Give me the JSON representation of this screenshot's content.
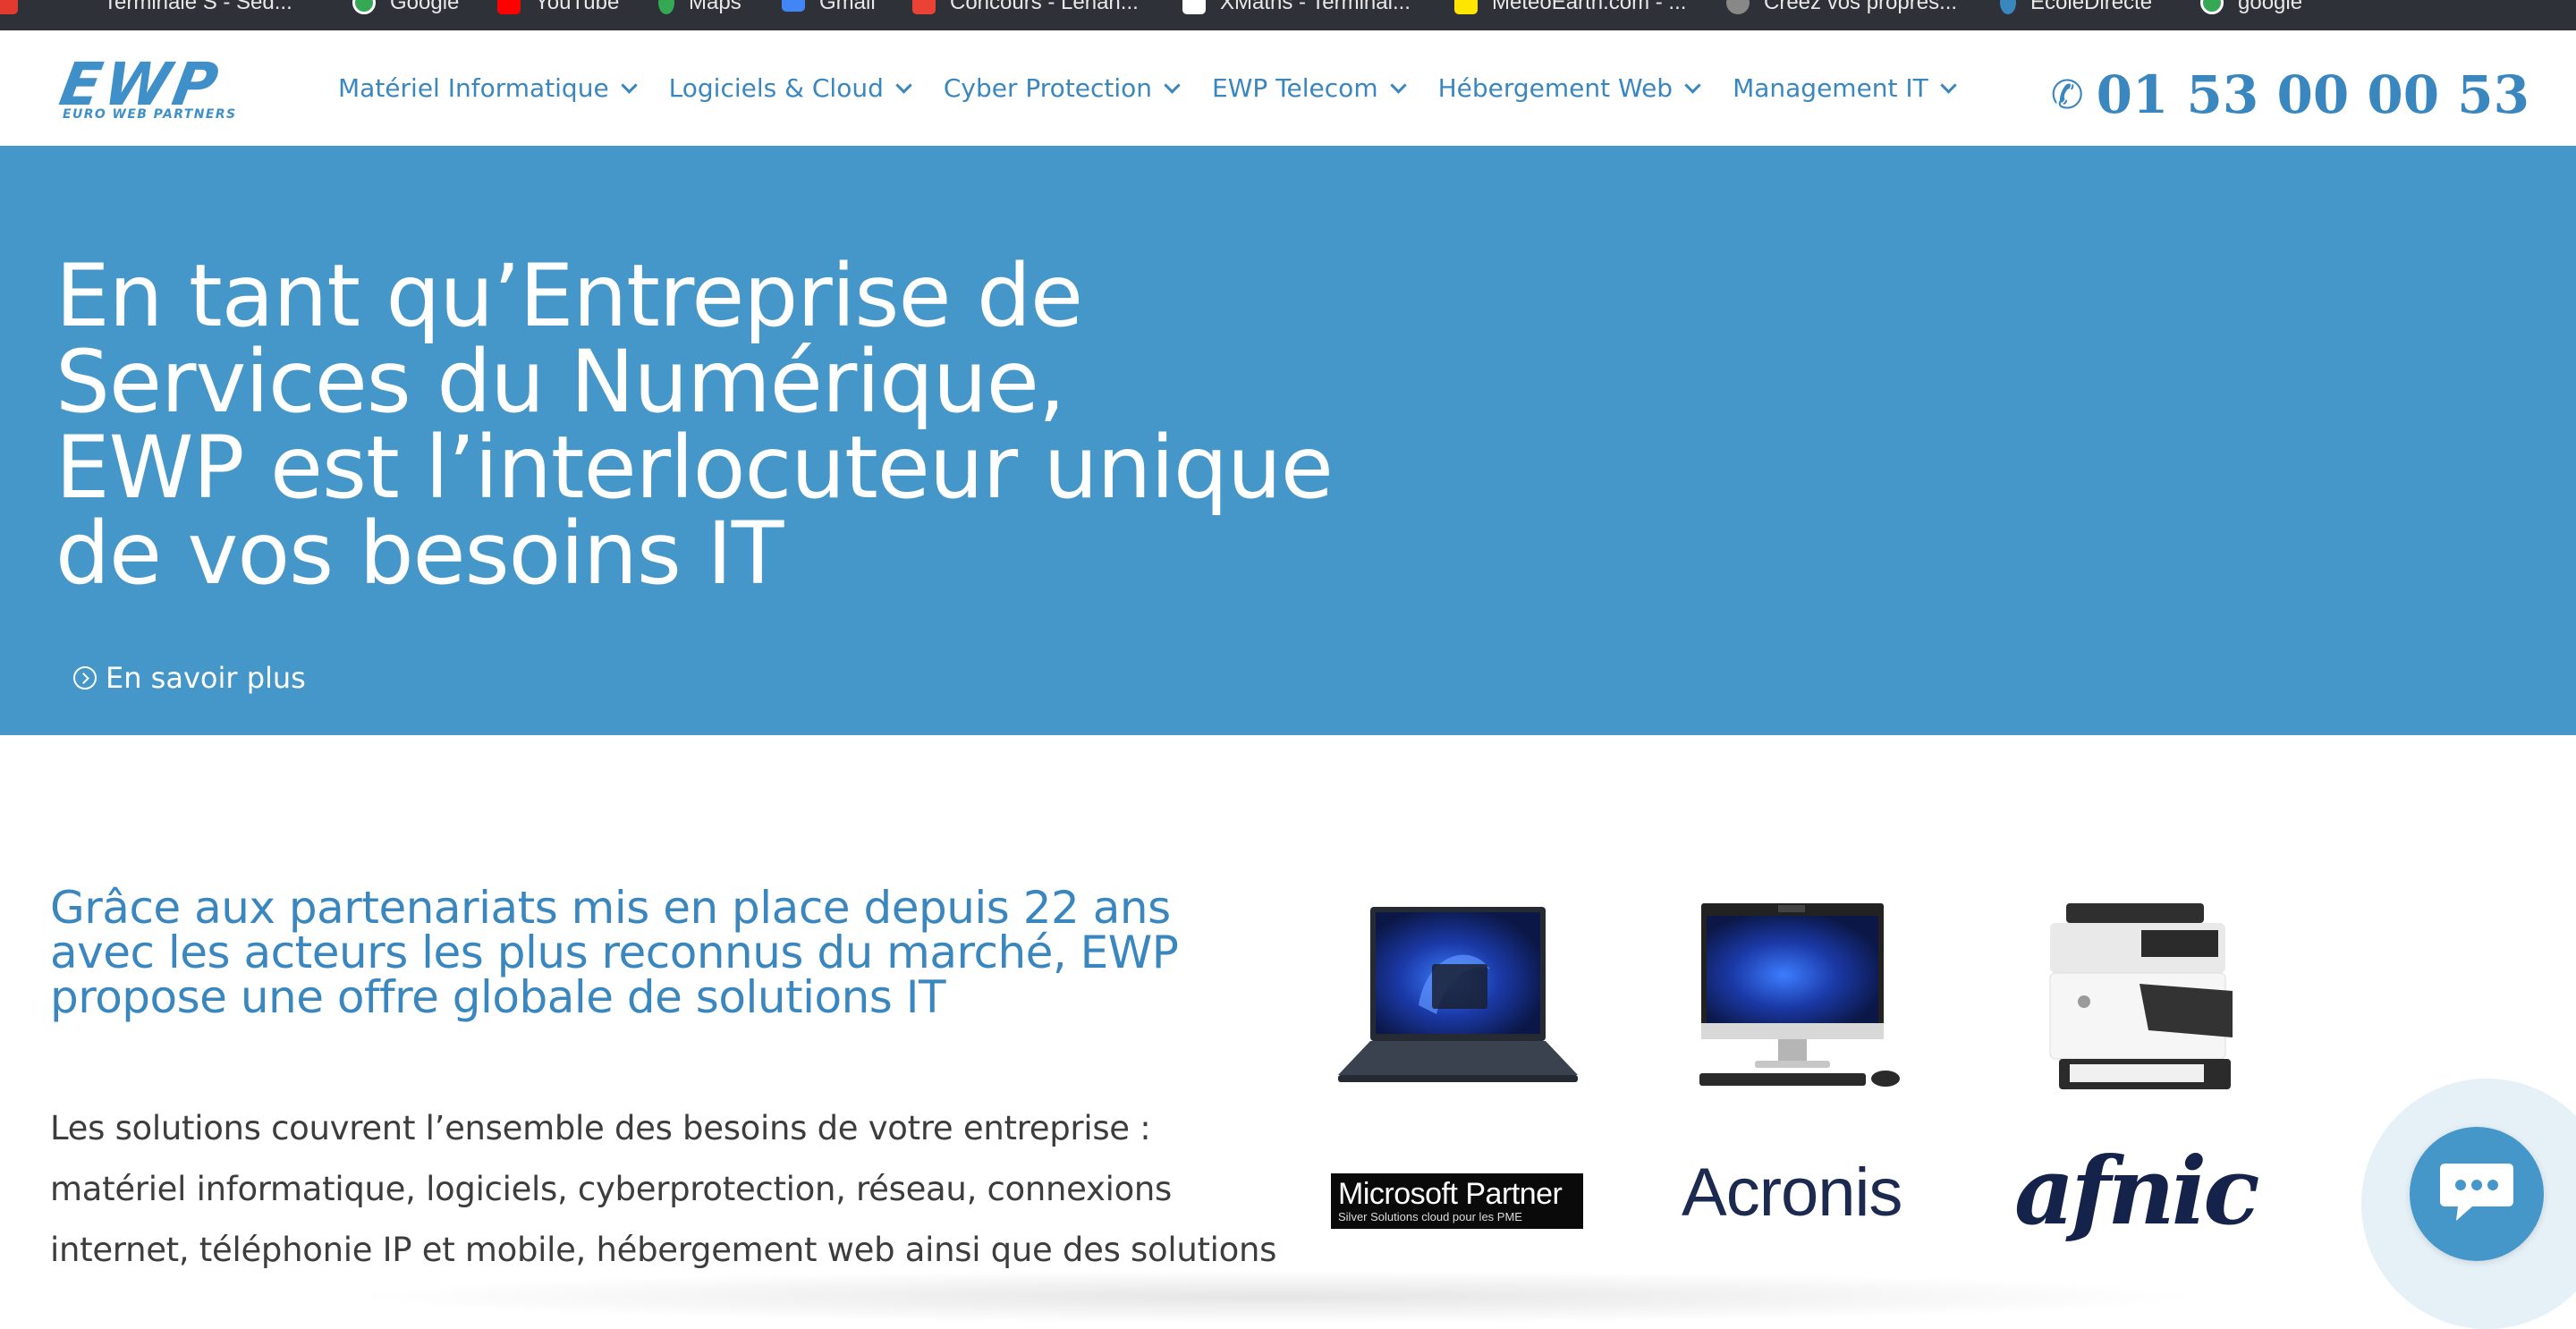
{
  "bookmarks": [
    {
      "label": "Terminale S - Sed...",
      "icon": "red-bookmark-icon",
      "color": "#e23a2e"
    },
    {
      "label": "Google",
      "icon": "google-icon",
      "color": "#34a853"
    },
    {
      "label": "YouTube",
      "icon": "youtube-icon",
      "color": "#ff0000"
    },
    {
      "label": "Maps",
      "icon": "maps-pin-icon",
      "color": "#34a853"
    },
    {
      "label": "Gmail",
      "icon": "gmail-icon",
      "color": "#4285f4"
    },
    {
      "label": "Concours - Lenan...",
      "icon": "calendar-icon",
      "color": "#ea4335"
    },
    {
      "label": "XMaths - Terminal...",
      "icon": "xmaths-icon",
      "color": "#ffffff"
    },
    {
      "label": "MeteoEarth.com - ...",
      "icon": "meteoearth-icon",
      "color": "#ffe600"
    },
    {
      "label": "Créez vos propres...",
      "icon": "globe-icon",
      "color": "#888888"
    },
    {
      "label": "EcoleDirecte",
      "icon": "ecoledirecte-icon",
      "color": "#3a86bf"
    },
    {
      "label": "google",
      "icon": "google-icon",
      "color": "#34a853"
    }
  ],
  "header": {
    "logo_text": "EWP",
    "logo_subtitle": "EURO WEB PARTNERS",
    "nav": [
      {
        "label": "Matériel Informatique"
      },
      {
        "label": "Logiciels & Cloud"
      },
      {
        "label": "Cyber Protection"
      },
      {
        "label": "EWP Telecom"
      },
      {
        "label": "Hébergement Web"
      },
      {
        "label": "Management IT"
      }
    ],
    "phone_icon": "✆",
    "phone": "01 53 00 00 53"
  },
  "hero": {
    "title_lines": [
      "En tant qu’Entreprise de",
      "Services du Numérique,",
      "EWP est l’interlocuteur unique",
      "de vos besoins IT"
    ],
    "cta_label": "En savoir plus"
  },
  "intro": {
    "lines": [
      "Grâce aux partenariats mis en place depuis 22 ans",
      "avec les acteurs les plus reconnus du marché, EWP",
      "propose une offre globale de solutions IT"
    ]
  },
  "body": {
    "lines": [
      "Les solutions couvrent l’ensemble des besoins de votre entreprise :",
      "matériel informatique, logiciels, cyberprotection, réseau, connexions",
      "internet, téléphonie IP et mobile, hébergement web ainsi que des solutions"
    ]
  },
  "partners": {
    "microsoft_name": "Microsoft Partner",
    "microsoft_tier": "Silver",
    "microsoft_sub": "Solutions cloud pour les PME",
    "acronis": "Acronis",
    "afnic": "afnic"
  },
  "colors": {
    "brand_blue": "#4597c9",
    "nav_blue": "#3a86bf",
    "bookmarks_bg": "#2e3138",
    "text_dark": "#3d3d3d"
  }
}
